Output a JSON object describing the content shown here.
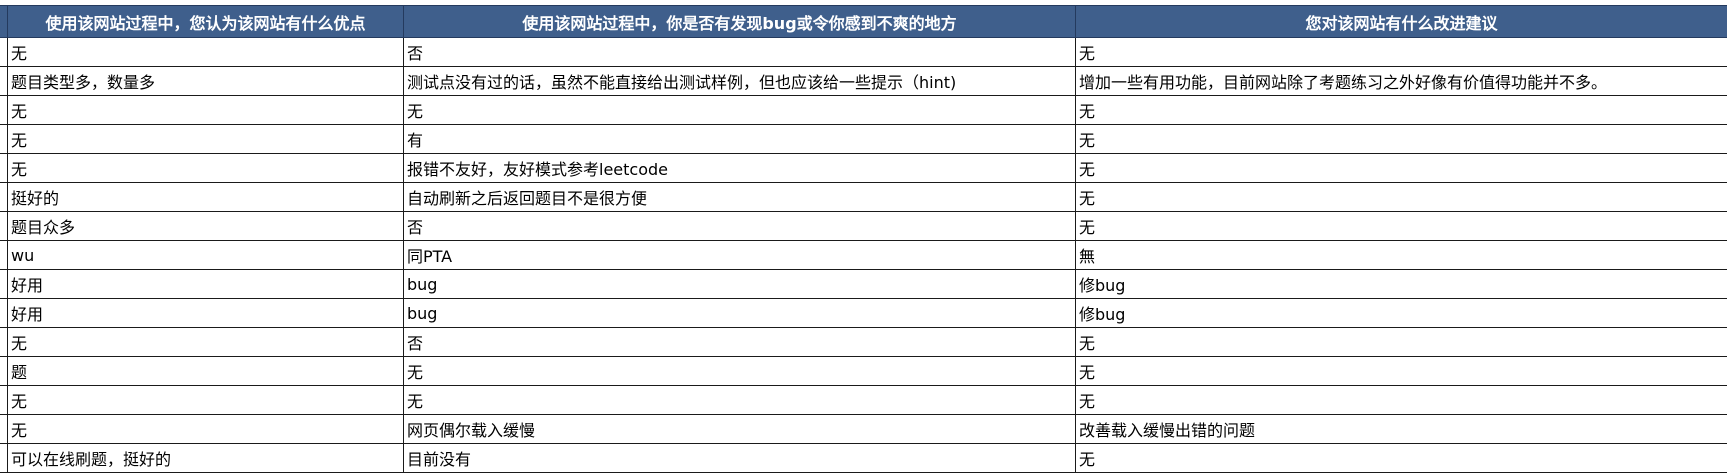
{
  "headers": [
    "使用该网站过程中，您认为该网站有什么优点",
    "使用该网站过程中，你是否有发现bug或令你感到不爽的地方",
    "您对该网站有什么改进建议"
  ],
  "rows": [
    [
      "无",
      "否",
      "无"
    ],
    [
      "题目类型多，数量多",
      "测试点没有过的话，虽然不能直接给出测试样例，但也应该给一些提示（hint)",
      "增加一些有用功能，目前网站除了考题练习之外好像有价值得功能并不多。"
    ],
    [
      "无",
      "无",
      "无"
    ],
    [
      "无",
      "有",
      "无"
    ],
    [
      "无",
      "报错不友好，友好模式参考leetcode",
      "无"
    ],
    [
      "挺好的",
      "自动刷新之后返回题目不是很方便",
      "无"
    ],
    [
      "题目众多",
      "否",
      "无"
    ],
    [
      "wu",
      "同PTA",
      "無"
    ],
    [
      "好用",
      "bug",
      "修bug"
    ],
    [
      "好用",
      "bug",
      "修bug"
    ],
    [
      "无",
      "否",
      "无"
    ],
    [
      "题",
      "无",
      "无"
    ],
    [
      "无",
      "无",
      "无"
    ],
    [
      "无",
      "网页偶尔载入缓慢",
      "改善载入缓慢出错的问题"
    ],
    [
      "可以在线刷题，挺好的",
      "目前没有",
      "无"
    ]
  ]
}
